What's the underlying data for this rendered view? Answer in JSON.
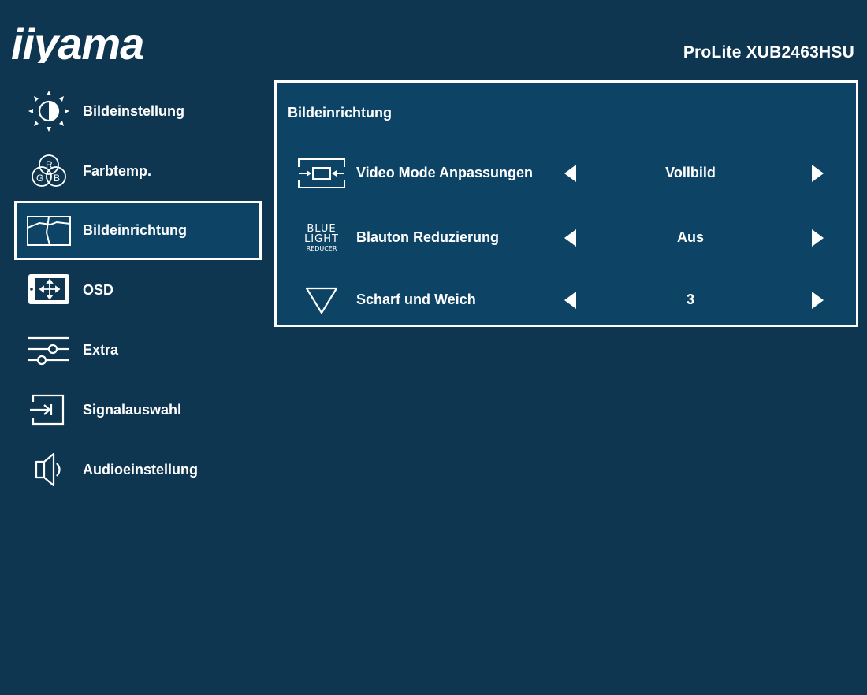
{
  "header": {
    "brand": "iiyama",
    "model": "ProLite XUB2463HSU"
  },
  "sidebar": {
    "items": [
      {
        "label": "Bildeinstellung",
        "icon": "brightness-icon",
        "selected": false
      },
      {
        "label": "Farbtemp.",
        "icon": "rgb-color-icon",
        "selected": false
      },
      {
        "label": "Bildeinrichtung",
        "icon": "image-setup-icon",
        "selected": true
      },
      {
        "label": "OSD",
        "icon": "osd-move-icon",
        "selected": false
      },
      {
        "label": "Extra",
        "icon": "sliders-icon",
        "selected": false
      },
      {
        "label": "Signalauswahl",
        "icon": "input-signal-icon",
        "selected": false
      },
      {
        "label": "Audioeinstellung",
        "icon": "speaker-icon",
        "selected": false
      }
    ]
  },
  "panel": {
    "title": "Bildeinrichtung",
    "rows": [
      {
        "label": "Video Mode Anpassungen",
        "value": "Vollbild",
        "icon": "video-mode-icon"
      },
      {
        "label": "Blauton Reduzierung",
        "value": "Aus",
        "icon": "blue-light-reducer-icon",
        "icon_text": [
          "BLUE",
          "LIGHT",
          "REDUCER"
        ]
      },
      {
        "label": "Scharf und Weich",
        "value": "3",
        "icon": "sharpness-triangle-icon"
      }
    ]
  },
  "colors": {
    "background": "#0e3651",
    "panel": "#0d4466",
    "border": "#ffffff",
    "text": "#ffffff"
  }
}
